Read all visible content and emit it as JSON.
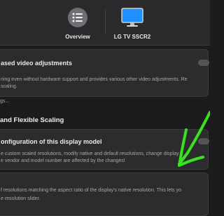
{
  "toolbar": {
    "overview_label": "Overview",
    "display_label": "LG TV SSCR2"
  },
  "video_card": {
    "title": "ased video adjustments",
    "desc_line1": "ning even without hardware support and provides various other video adjustments. Re",
    "desc_line2": "scaling."
  },
  "link_text": "gs...",
  "section": {
    "heading": "and Flexible Scaling"
  },
  "config_card": {
    "title": "onfiguration of this display model",
    "desc_line1": "e custom scaled resolutions, modify native and default resolutions, change display n",
    "desc_line2": "e vendor and model number are affected by the changes!"
  },
  "resolution_card": {
    "desc_line1": "f resolutions matching the aspect ratio of the display's native resolution. This lets yo",
    "desc_line2": "e resolution slider."
  },
  "colors": {
    "accent_blue": "#1e90ff",
    "annotation_green": "#39e21f"
  }
}
